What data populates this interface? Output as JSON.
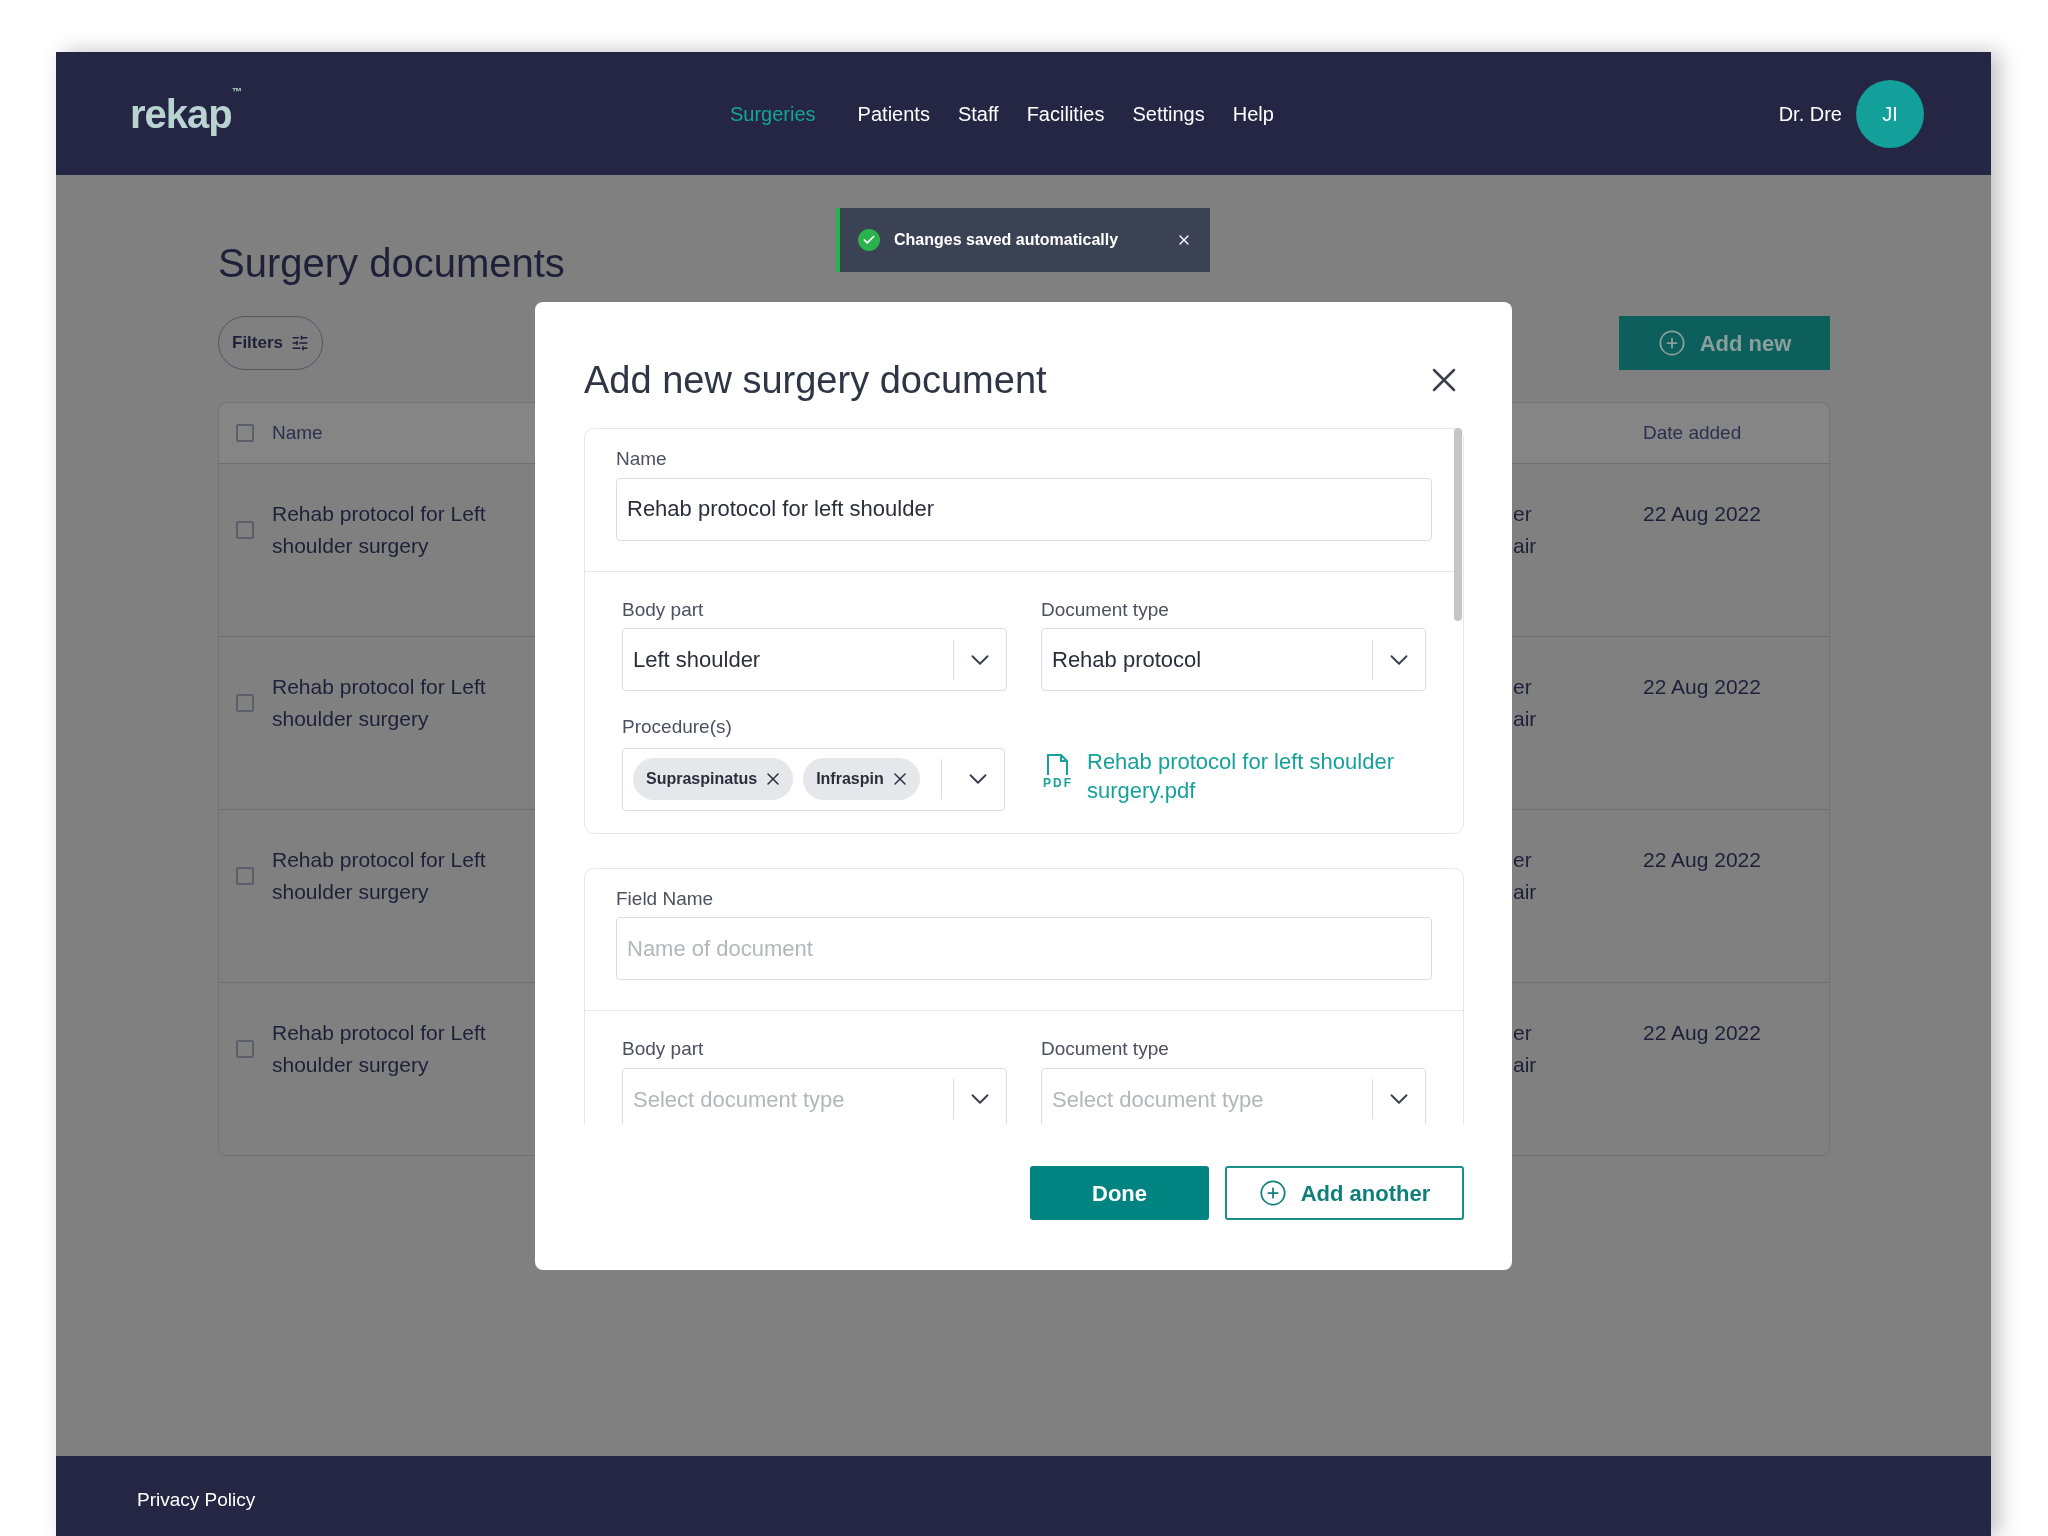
{
  "header": {
    "logo": "rekap",
    "logo_mark": "™",
    "nav": [
      {
        "label": "Surgeries",
        "selected": true
      },
      {
        "label": "Patients",
        "selected": false
      },
      {
        "label": "Staff",
        "selected": false
      },
      {
        "label": "Facilities",
        "selected": false
      },
      {
        "label": "Settings",
        "selected": false
      },
      {
        "label": "Help",
        "selected": false
      }
    ],
    "user": {
      "name": "Dr. Dre",
      "initials": "JI"
    }
  },
  "page": {
    "title": "Surgery documents",
    "filters": "Filters",
    "add_new": "Add new"
  },
  "table": {
    "all_checked": false,
    "columns": [
      "Name",
      "Date added"
    ],
    "rows": [
      {
        "checked": false,
        "name": "Rehab protocol for Left shoulder surgery",
        "column_2": [
          "er",
          "air"
        ],
        "date": "22 Aug 2022"
      },
      {
        "checked": false,
        "name": "Rehab protocol for Left shoulder surgery",
        "column_2": [
          "er",
          "air"
        ],
        "date": "22 Aug 2022"
      },
      {
        "checked": false,
        "name": "Rehab protocol for Left shoulder surgery",
        "column_2": [
          "er",
          "air"
        ],
        "date": "22 Aug 2022"
      },
      {
        "checked": false,
        "name": "Rehab protocol for Left shoulder surgery",
        "column_2": [
          "er",
          "air"
        ],
        "date": "22 Aug 2022"
      }
    ]
  },
  "toast": {
    "message": "Changes saved automatically"
  },
  "modal": {
    "title": "Add new surgery document",
    "forms": [
      {
        "name": {
          "label": "Name",
          "value": "Rehab protocol for left shoulder"
        },
        "body_part": {
          "label": "Body part",
          "value": "Left shoulder"
        },
        "document_type": {
          "label": "Document type",
          "value": "Rehab protocol"
        },
        "procedures": {
          "label": "Procedure(s)",
          "tags": [
            "Supraspinatus",
            "Infraspin"
          ]
        },
        "file": {
          "badge": "PDF",
          "name": "Rehab protocol for left shoulder surgery.pdf"
        }
      },
      {
        "name": {
          "label": "Field Name",
          "placeholder": "Name of document"
        },
        "body_part": {
          "label": "Body part",
          "placeholder": "Select document type"
        },
        "document_type": {
          "label": "Document type",
          "placeholder": "Select document type"
        }
      }
    ],
    "done": "Done",
    "add_another": "Add another"
  },
  "footer": {
    "links": [
      "Privacy Policy"
    ]
  }
}
